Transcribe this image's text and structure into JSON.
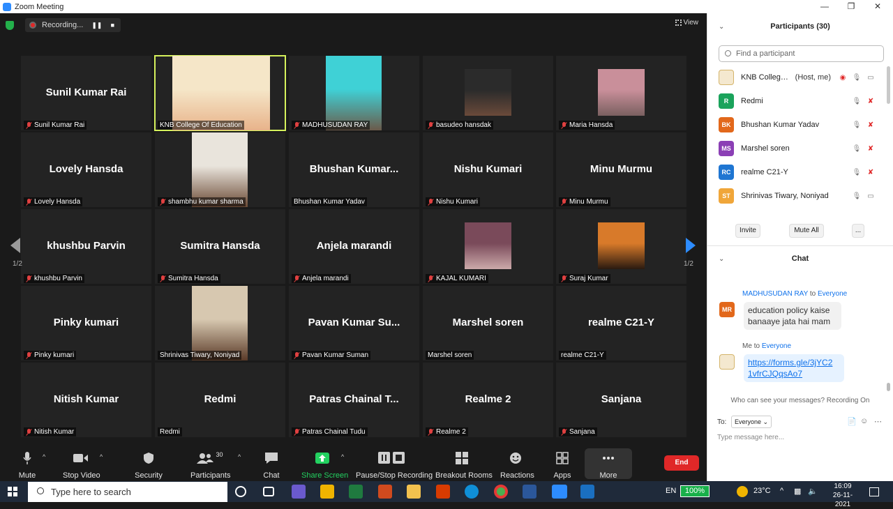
{
  "window": {
    "title": "Zoom Meeting"
  },
  "recording": {
    "label": "Recording..."
  },
  "view_label": "View",
  "tiles": [
    {
      "big": "Sunil Kumar Rai",
      "caption": "Sunil Kumar Rai",
      "muted": true,
      "video": false
    },
    {
      "big": "",
      "caption": "KNB College Of Education",
      "muted": false,
      "video": true,
      "active": true
    },
    {
      "big": "",
      "caption": "MADHUSUDAN RAY",
      "muted": true,
      "video": true
    },
    {
      "big": "",
      "caption": "basudeo hansdak",
      "muted": true,
      "video": true
    },
    {
      "big": "",
      "caption": "Maria Hansda",
      "muted": true,
      "video": true
    },
    {
      "big": "Lovely Hansda",
      "caption": "Lovely Hansda",
      "muted": true,
      "video": false
    },
    {
      "big": "",
      "caption": "shambhu kumar sharma",
      "muted": true,
      "video": true
    },
    {
      "big": "Bhushan  Kumar...",
      "caption": "Bhushan Kumar Yadav",
      "muted": false,
      "video": false
    },
    {
      "big": "Nishu Kumari",
      "caption": "Nishu Kumari",
      "muted": true,
      "video": false
    },
    {
      "big": "Minu Murmu",
      "caption": "Minu Murmu",
      "muted": true,
      "video": false
    },
    {
      "big": "khushbu Parvin",
      "caption": "khushbu Parvin",
      "muted": true,
      "video": false
    },
    {
      "big": "Sumitra Hansda",
      "caption": "Sumitra Hansda",
      "muted": true,
      "video": false
    },
    {
      "big": "Anjela marandi",
      "caption": "Anjela marandi",
      "muted": true,
      "video": false
    },
    {
      "big": "",
      "caption": "KAJAL KUMARI",
      "muted": true,
      "video": true
    },
    {
      "big": "",
      "caption": "Suraj Kumar",
      "muted": true,
      "video": true
    },
    {
      "big": "Pinky kumari",
      "caption": "Pinky kumari",
      "muted": true,
      "video": false
    },
    {
      "big": "",
      "caption": "Shrinivas Tiwary, Noniyad",
      "muted": false,
      "video": true
    },
    {
      "big": "Pavan  Kumar Su...",
      "caption": "Pavan Kumar Suman",
      "muted": true,
      "video": false
    },
    {
      "big": "Marshel soren",
      "caption": "Marshel soren",
      "muted": false,
      "video": false
    },
    {
      "big": "realme C21-Y",
      "caption": "realme C21-Y",
      "muted": false,
      "video": false
    },
    {
      "big": "Nitish Kumar",
      "caption": "Nitish Kumar",
      "muted": true,
      "video": false
    },
    {
      "big": "Redmi",
      "caption": "Redmi",
      "muted": false,
      "video": false
    },
    {
      "big": "Patras Chainal T...",
      "caption": "Patras Chainal Tudu",
      "muted": true,
      "video": false
    },
    {
      "big": "Realme 2",
      "caption": "Realme 2",
      "muted": true,
      "video": false
    },
    {
      "big": "Sanjana",
      "caption": "Sanjana",
      "muted": true,
      "video": false
    }
  ],
  "page_indicator": "1/2",
  "toolbar": {
    "mute": "Mute",
    "stop_video": "Stop Video",
    "security": "Security",
    "participants": "Participants",
    "participant_count": "30",
    "chat": "Chat",
    "share_screen": "Share Screen",
    "recording": "Pause/Stop Recording",
    "breakout": "Breakout Rooms",
    "reactions": "Reactions",
    "apps": "Apps",
    "more": "More",
    "end": "End"
  },
  "participants_panel": {
    "title": "Participants (30)",
    "search_placeholder": "Find a participant",
    "rows": [
      {
        "initials": "",
        "name": "KNB College Of E...",
        "role": "(Host, me)",
        "color": "",
        "image": true
      },
      {
        "initials": "R",
        "name": "Redmi",
        "role": "",
        "color": "#1aa35b"
      },
      {
        "initials": "BK",
        "name": "Bhushan Kumar Yadav",
        "role": "",
        "color": "#e2681b"
      },
      {
        "initials": "MS",
        "name": "Marshel soren",
        "role": "",
        "color": "#8b3fb5"
      },
      {
        "initials": "RC",
        "name": "realme C21-Y",
        "role": "",
        "color": "#1f76d2"
      },
      {
        "initials": "ST",
        "name": "Shrinivas Tiwary, Noniyad",
        "role": "",
        "color": "#f0a63a"
      }
    ],
    "invite": "Invite",
    "mute_all": "Mute All",
    "more": "..."
  },
  "chat_panel": {
    "title": "Chat",
    "messages": [
      {
        "sender": "MADHUSUDAN RAY",
        "to_word": "to",
        "to": "Everyone",
        "initials": "MR",
        "text_line1": "education policy kaise",
        "text_line2": "banaaye jata hai mam"
      },
      {
        "sender": "Me",
        "to_word": "to",
        "to": "Everyone",
        "initials": "",
        "text_line1": "https://forms.gle/3jYC2",
        "text_line2": "1vfrCJQqsAo7"
      }
    ],
    "who_can_see": "Who can see your messages? Recording On",
    "to_label": "To:",
    "to_value": "Everyone",
    "input_placeholder": "Type message here..."
  },
  "taskbar": {
    "search_placeholder": "Type here to search",
    "lang": "EN",
    "battery": "100%",
    "temperature": "23°C",
    "time": "16:09",
    "date": "26-11-2021"
  },
  "colors": {
    "accent": "#2d8cff",
    "end": "#e02828",
    "active_speaker": "#d6f25c",
    "share": "#23d160"
  }
}
